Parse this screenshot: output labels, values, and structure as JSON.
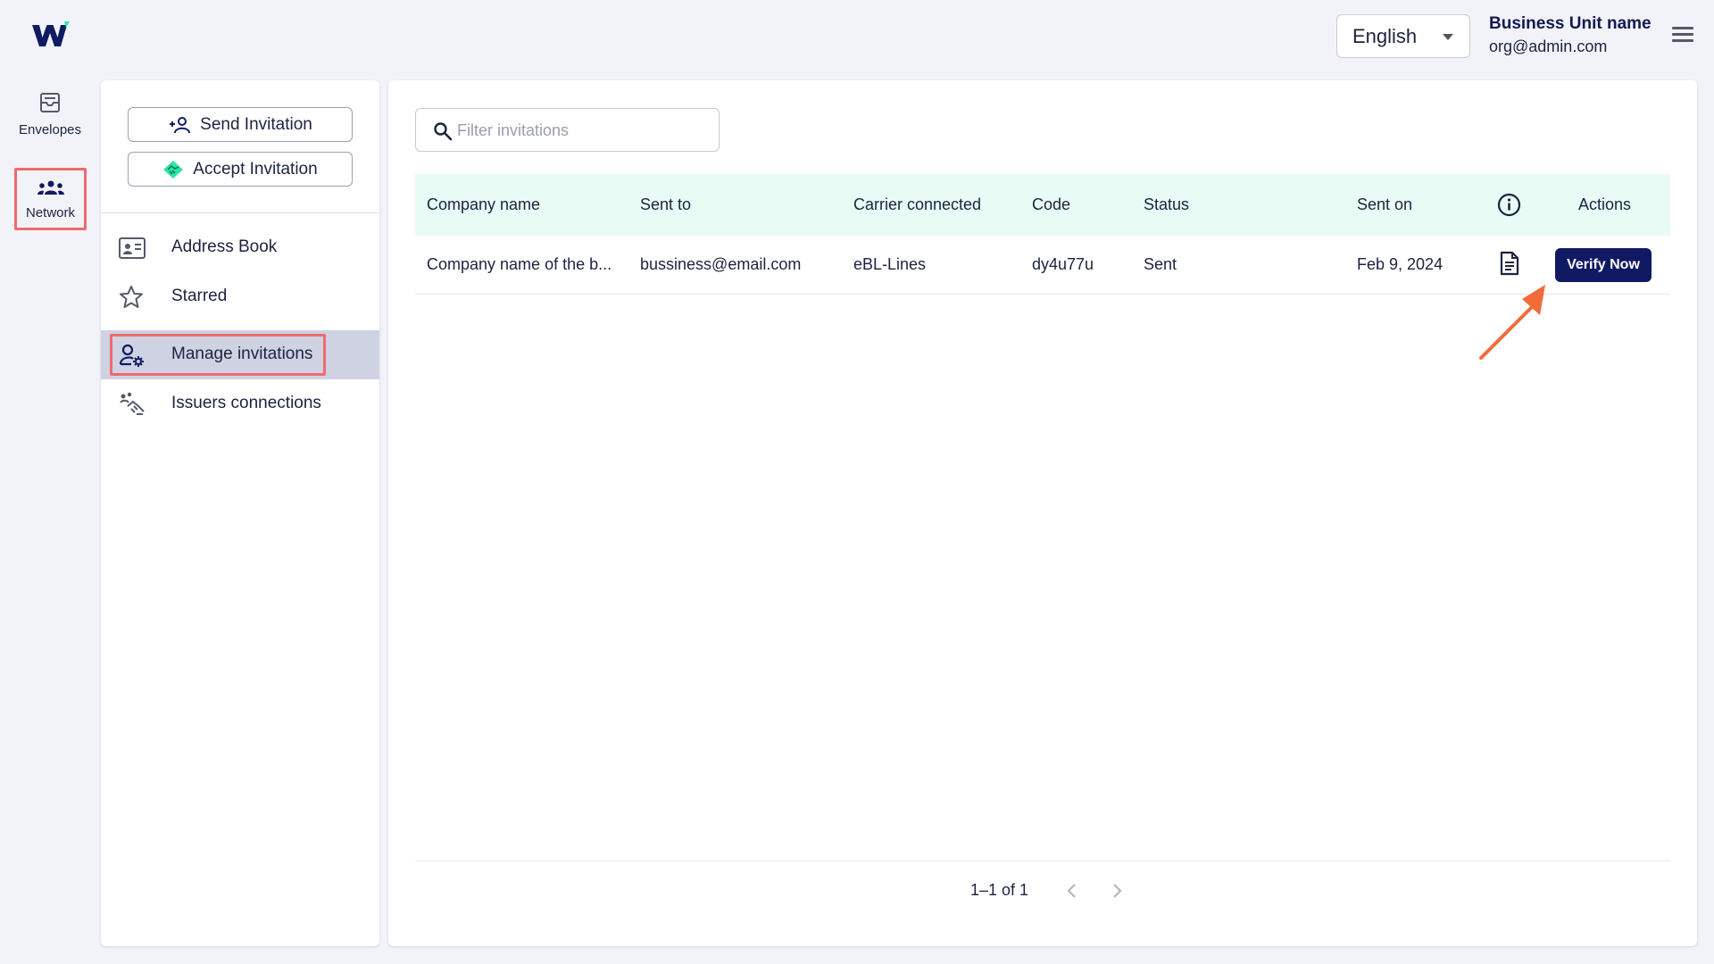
{
  "header": {
    "language": "English",
    "business_unit_name": "Business Unit name",
    "business_unit_email": "org@admin.com"
  },
  "rail": {
    "items": [
      {
        "label": "Envelopes",
        "icon": "envelopes-icon"
      },
      {
        "label": "Network",
        "icon": "network-icon",
        "active": true
      }
    ]
  },
  "sidebar": {
    "send_invitation": "Send Invitation",
    "accept_invitation": "Accept Invitation",
    "nav": [
      {
        "label": "Address Book",
        "icon": "address-book-icon"
      },
      {
        "label": "Starred",
        "icon": "star-icon"
      },
      {
        "label": "Manage invitations",
        "icon": "manage-invitations-icon",
        "active": true
      },
      {
        "label": "Issuers connections",
        "icon": "issuers-connections-icon"
      }
    ]
  },
  "filter": {
    "placeholder": "Filter invitations"
  },
  "table": {
    "columns": [
      "Company name",
      "Sent to",
      "Carrier connected",
      "Code",
      "Status",
      "Sent on",
      "Actions"
    ],
    "rows": [
      {
        "company": "Company name of the b...",
        "sent_to": "bussiness@email.com",
        "carrier": "eBL-Lines",
        "code": "dy4u77u",
        "status": "Sent",
        "sent_on": "Feb 9, 2024",
        "action": "Verify Now"
      }
    ]
  },
  "pagination": {
    "text": "1–1 of 1"
  },
  "colors": {
    "brand_navy": "#101a63",
    "brand_green": "#2ee5a5",
    "header_row": "#e8fbf4",
    "active_nav": "#ced2e3",
    "highlight": "#f06b6b",
    "annotation_arrow": "#f26b3a"
  }
}
